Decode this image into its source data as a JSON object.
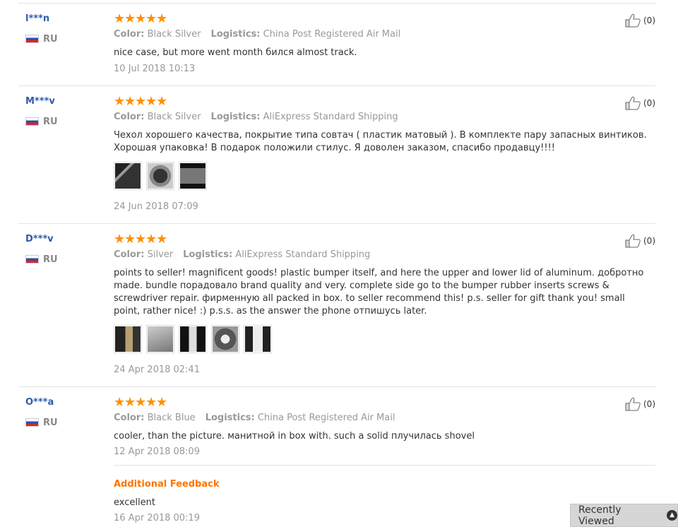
{
  "thumb_label": "(0)",
  "reviews": [
    {
      "user": "l***n",
      "country": "RU",
      "color_label": "Color:",
      "color": "Black Silver",
      "logistics_label": "Logistics:",
      "logistics": "China Post Registered Air Mail",
      "text": "nice case, but more went month бился almost track.",
      "date": "10 Jul 2018 10:13"
    },
    {
      "user": "M***v",
      "country": "RU",
      "color_label": "Color:",
      "color": "Black Silver",
      "logistics_label": "Logistics:",
      "logistics": "AliExpress Standard Shipping",
      "text": "Чехол хорошего качества, покрытие типа совтач ( пластик матовый ). В комплекте пару запасных винтиков. Хорошая упаковка! В подарок положили стилус. Я доволен заказом, спасибо продавцу!!!!",
      "date": "24 Jun 2018 07:09"
    },
    {
      "user": "D***v",
      "country": "RU",
      "color_label": "Color:",
      "color": "Silver",
      "logistics_label": "Logistics:",
      "logistics": "AliExpress Standard Shipping",
      "text": "points to seller! magnificent goods! plastic bumper itself, and here the upper and lower lid of aluminum. добротно made. bundle порадовало brand quality and very. complete side go to the bumper rubber inserts screws & screwdriver repair. фирменную all packed in box. to seller recommend this! p.s. seller for gift thank you! small point, rather nice! :) p.s.s. as the answer the phone отпишусь later.",
      "date": "24 Apr 2018 02:41"
    },
    {
      "user": "O***a",
      "country": "RU",
      "color_label": "Color:",
      "color": "Black Blue",
      "logistics_label": "Logistics:",
      "logistics": "China Post Registered Air Mail",
      "text": "cooler, than the picture. манитной in box with. such a solid плучилась shovel",
      "date": "12 Apr 2018 08:09",
      "additional_label": "Additional Feedback",
      "additional_text": "excellent",
      "additional_date": "16 Apr 2018 00:19"
    }
  ],
  "recently_viewed": "Recently Viewed"
}
